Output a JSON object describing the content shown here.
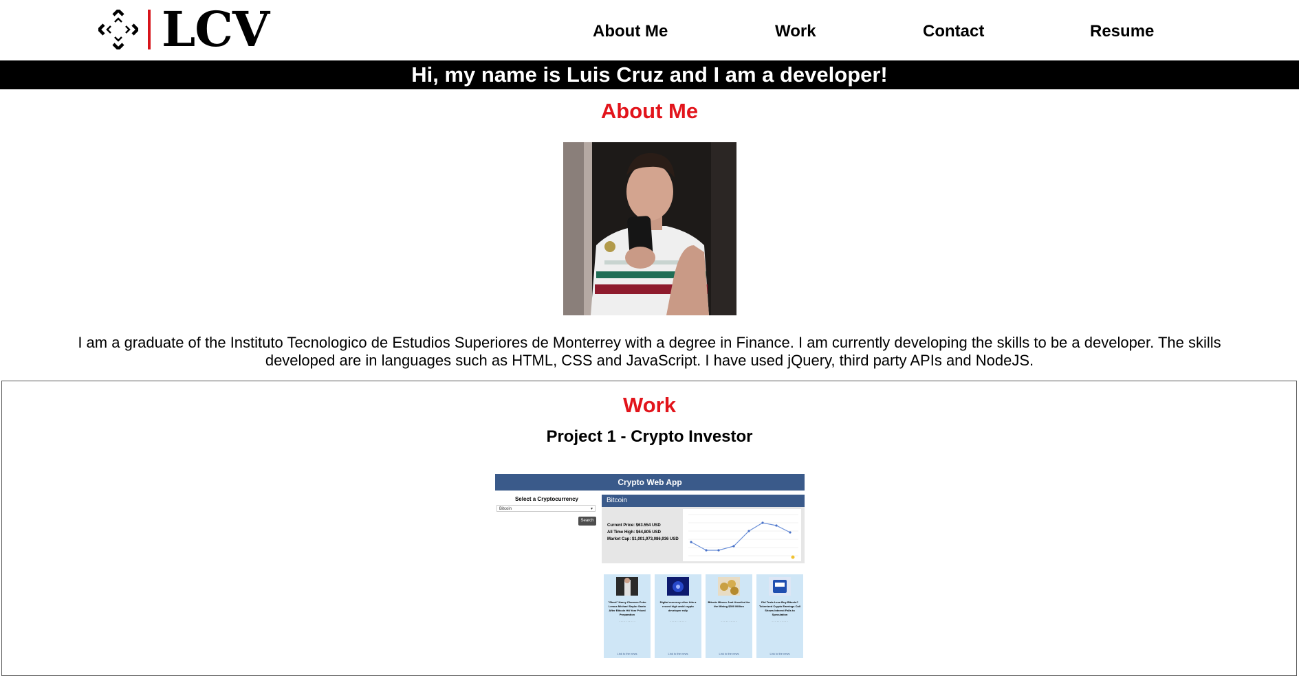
{
  "header": {
    "logo_text": "LCV",
    "nav": [
      "About Me",
      "Work",
      "Contact",
      "Resume"
    ]
  },
  "banner": "Hi, my name is Luis Cruz and I am a developer!",
  "about": {
    "title": "About Me",
    "text": "I am a graduate of the Instituto Tecnologico de Estudios Superiores de Monterrey with a degree in Finance. I am currently developing the skills to be a developer. The skills developed are in languages such as HTML, CSS and JavaScript. I have used jQuery, third party APIs and NodeJS."
  },
  "work": {
    "title": "Work",
    "project_title": "Project 1 - Crypto Investor",
    "screenshot": {
      "app_title": "Crypto Web App",
      "select_label": "Select a Cryptocurrency",
      "select_value": "Bitcoin",
      "search_label": "Search",
      "coin": "Bitcoin",
      "current_price": "Current Price: $63.554 USD",
      "all_time_high": "All Time High: $64,805 USD",
      "market_cap": "Market Cap: $1,001,973,086,936 USD",
      "news": [
        {
          "title": "\"Short\" Harvy Chooses Peter Lemus Michael Saylor Santo After Bitcoin Hit Year Priced Preparation",
          "link": "Link to the news"
        },
        {
          "title": "Digital currency ether hits a record high amid crypto developer rally",
          "link": "Link to the news"
        },
        {
          "title": "Bitcoin Miners Just Unveiled for the Mining $300 Million",
          "link": "Link to the news"
        },
        {
          "title": "Did Tesla Lose Buy Bitcoin? Tokenized Crypto Earnings Call Shows Interest Falls to Speculation",
          "link": "Link to the news"
        }
      ]
    }
  },
  "colors": {
    "accent_red": "#e2141b",
    "banner_bg": "#000000",
    "app_blue": "#3a5a8a"
  }
}
